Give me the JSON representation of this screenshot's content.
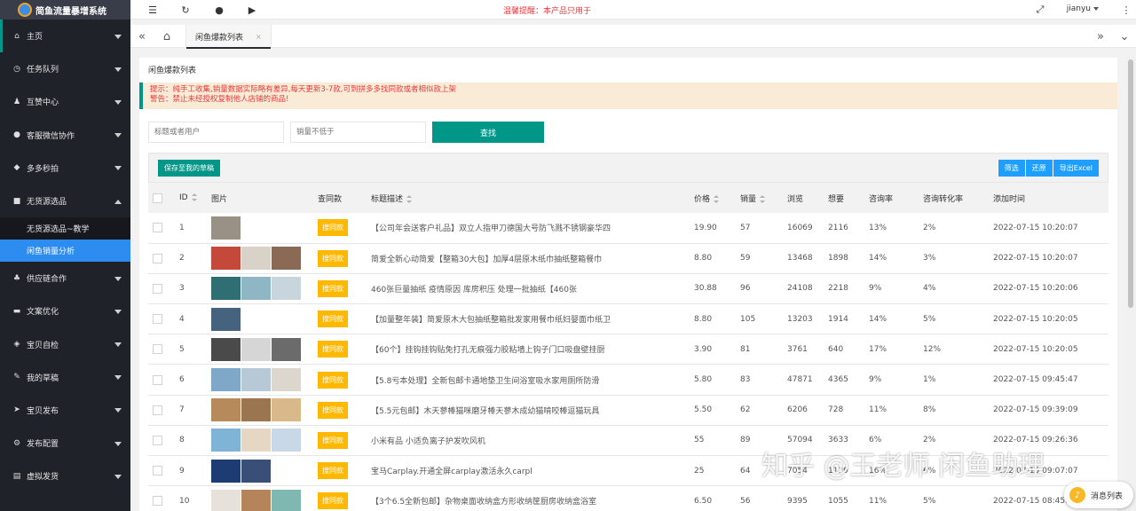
{
  "app": {
    "title": "简鱼流量暴增系统"
  },
  "sidebar": {
    "items": [
      {
        "label": "主页",
        "icon": "home-icon",
        "glyph": "⌂"
      },
      {
        "label": "任务队列",
        "icon": "dashboard-icon",
        "glyph": "◷"
      },
      {
        "label": "互赞中心",
        "icon": "users-icon",
        "glyph": "♟"
      },
      {
        "label": "客服微信协作",
        "icon": "chat-icon",
        "glyph": "●"
      },
      {
        "label": "多多秒拍",
        "icon": "bell-icon",
        "glyph": "◆"
      },
      {
        "label": "无货源选品",
        "icon": "gift-icon",
        "glyph": "■"
      },
      {
        "label": "供应链合作",
        "icon": "network-icon",
        "glyph": "♣"
      },
      {
        "label": "文案优化",
        "icon": "truck-icon",
        "glyph": "▬"
      },
      {
        "label": "宝贝自检",
        "icon": "shield-icon",
        "glyph": "◈"
      },
      {
        "label": "我的草稿",
        "icon": "edit-icon",
        "glyph": "✎"
      },
      {
        "label": "宝贝发布",
        "icon": "send-icon",
        "glyph": "➤"
      },
      {
        "label": "发布配置",
        "icon": "settings-icon",
        "glyph": "⚙"
      },
      {
        "label": "虚拟发货",
        "icon": "list-icon",
        "glyph": "▤"
      }
    ],
    "subitems": [
      {
        "label": "无货源选品~教学"
      },
      {
        "label": "闲鱼销量分析"
      }
    ]
  },
  "topbar": {
    "notice": "温馨提醒：本产品只用于",
    "user": "jianyu"
  },
  "tabbar": {
    "tab_label": "闲鱼爆款列表",
    "close": "×"
  },
  "content": {
    "title": "闲鱼爆款列表",
    "tip1": "提示：纯手工收集,销量数据实际略有差异,每天更新3-7款,可到拼多多找同款或者相似款上架",
    "tip2": "警告：禁止未经授权复制他人店铺的商品!",
    "filter": {
      "keyword_placeholder": "标题或者用户",
      "sales_placeholder": "销量不低于",
      "search_label": "查找"
    },
    "toolbar": {
      "save_label": "保存至我的草稿",
      "filter_label": "筛选",
      "reset_label": "还原",
      "export_label": "导出Excel"
    },
    "columns": {
      "id": "ID",
      "image": "图片",
      "find": "查同款",
      "title": "标题描述",
      "price": "价格",
      "sales": "销量",
      "views": "浏览",
      "wants": "想要",
      "inquiry": "咨询率",
      "conversion": "咨询转化率",
      "added": "添加时间"
    },
    "find_button": "搜同款",
    "rows": [
      {
        "id": "1",
        "title": "【公司年会送客户礼品】双立人指甲刀德国大号防飞溅不锈钢豪华四",
        "price": "19.90",
        "sales": "57",
        "views": "16069",
        "wants": "2116",
        "inquiry": "13%",
        "conversion": "2%",
        "added": "2022-07-15 10:20:07",
        "thumbs": [
          "#9a9186"
        ]
      },
      {
        "id": "2",
        "title": "简爱全新心动简爱【整箱30大包】加厚4层原木纸巾抽纸整箱餐巾",
        "price": "8.80",
        "sales": "59",
        "views": "13468",
        "wants": "1898",
        "inquiry": "14%",
        "conversion": "3%",
        "added": "2022-07-15 10:20:07",
        "thumbs": [
          "#c4493a",
          "#d8d2c8",
          "#8a6a55"
        ]
      },
      {
        "id": "3",
        "title": "460张巨量抽纸 疫情原因 库房积压 处理一批抽纸【460张",
        "price": "30.88",
        "sales": "96",
        "views": "24108",
        "wants": "2218",
        "inquiry": "9%",
        "conversion": "4%",
        "added": "2022-07-15 10:20:06",
        "thumbs": [
          "#2f6f74",
          "#8fb6c4",
          "#c9d5dc"
        ]
      },
      {
        "id": "4",
        "title": "【加量整年装】简爱原木大包抽纸整箱批发家用餐巾纸妇婴面巾纸卫",
        "price": "8.80",
        "sales": "105",
        "views": "13203",
        "wants": "1914",
        "inquiry": "14%",
        "conversion": "5%",
        "added": "2022-07-15 10:20:05",
        "thumbs": [
          "#45627f"
        ]
      },
      {
        "id": "5",
        "title": "【60个】挂钩挂钩贴免打孔无痕强力胶粘墙上钩子门口吸盘壁挂厨",
        "price": "3.90",
        "sales": "81",
        "views": "3761",
        "wants": "640",
        "inquiry": "17%",
        "conversion": "12%",
        "added": "2022-07-15 10:20:05",
        "thumbs": [
          "#4a4a4a",
          "#d6d6d6",
          "#6b6b6b"
        ]
      },
      {
        "id": "6",
        "title": "【5.8亏本处理】全新包邮卡通地垫卫生间浴室吸水家用厕所防滑",
        "price": "5.80",
        "sales": "83",
        "views": "47871",
        "wants": "4365",
        "inquiry": "9%",
        "conversion": "1%",
        "added": "2022-07-15 09:45:47",
        "thumbs": [
          "#7fa8c8",
          "#b7c9d6",
          "#dcd6cc"
        ]
      },
      {
        "id": "7",
        "title": "【5.5元包邮】木天蓼棒猫咪磨牙棒天蓼木成幼猫啃咬棒逗猫玩具",
        "price": "5.50",
        "sales": "62",
        "views": "6206",
        "wants": "728",
        "inquiry": "11%",
        "conversion": "8%",
        "added": "2022-07-15 09:39:09",
        "thumbs": [
          "#b78a5c",
          "#9a7550",
          "#d9b98a"
        ]
      },
      {
        "id": "8",
        "title": "小米有品 小适负离子护发吹风机",
        "price": "55",
        "sales": "89",
        "views": "57094",
        "wants": "3633",
        "inquiry": "6%",
        "conversion": "2%",
        "added": "2022-07-15 09:26:36",
        "thumbs": [
          "#7fb4d6",
          "#e6d6c4",
          "#c8d8e6"
        ]
      },
      {
        "id": "9",
        "title": "宝马Carplay.开通全屏carplay激活永久carpl",
        "price": "25",
        "sales": "64",
        "views": "7054",
        "wants": "1129",
        "inquiry": "16%",
        "conversion": "6%",
        "added": "2022-07-15 09:07:07",
        "thumbs": [
          "#1d3c73",
          "#3a4f78"
        ]
      },
      {
        "id": "10",
        "title": "【3个6.5全新包邮】杂物桌面收纳盒方形收纳筐厨房收纳盒浴室",
        "price": "6.50",
        "sales": "56",
        "views": "9395",
        "wants": "1055",
        "inquiry": "11%",
        "conversion": "5%",
        "added": "2022-07-15 08:45:00",
        "thumbs": [
          "#e6e1da",
          "#b5845a",
          "#7fb8b0"
        ]
      }
    ]
  },
  "watermark": "知乎 @王老师 闲鱼助理",
  "message_button": "消息列表"
}
